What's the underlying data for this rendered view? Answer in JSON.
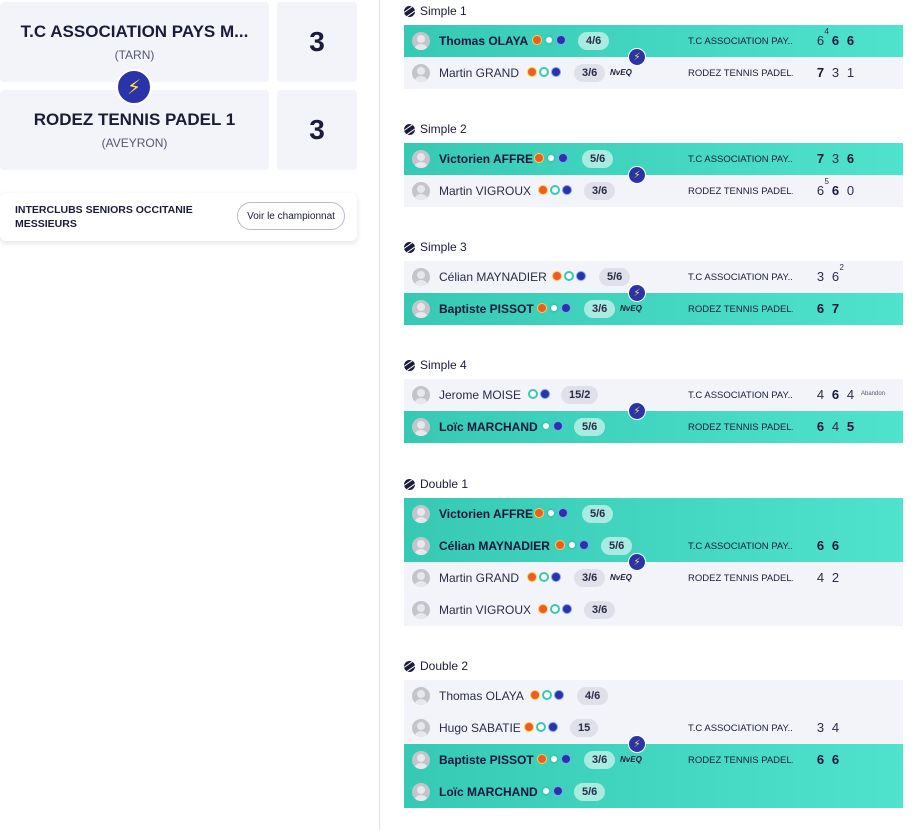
{
  "home_team": {
    "name": "T.C ASSOCIATION PAYS M...",
    "region": "(TARN)",
    "score": "3"
  },
  "away_team": {
    "name": "RODEZ TENNIS PADEL 1",
    "region": "(AVEYRON)",
    "score": "3"
  },
  "vs_icon": "lightning-icon",
  "championship": {
    "label_line1": "INTERCLUBS SENIORS OCCITANIE",
    "label_line2": "MESSIEURS",
    "button": "Voir le championnat"
  },
  "colors": {
    "winner_row": "#36c9b3",
    "badge": "#2a34a8",
    "bolt": "#ffe23a"
  },
  "matches": {
    "s1": {
      "title": "Simple 1",
      "r1": {
        "player": "Thomas OLAYA",
        "rank": "4/6",
        "nveq": "",
        "club": "T.C ASSOCIATION PAY...",
        "sets": [
          "6",
          "6",
          "6"
        ],
        "tb": [
          "4",
          "",
          ""
        ],
        "note": ""
      },
      "r2": {
        "player": "Martin GRAND",
        "rank": "3/6",
        "nveq": "NvEQ",
        "club": "RODEZ TENNIS PADEL...",
        "sets": [
          "7",
          "3",
          "1"
        ],
        "tb": [
          "",
          "",
          ""
        ],
        "note": ""
      }
    },
    "s2": {
      "title": "Simple 2",
      "r1": {
        "player": "Victorien AFFRE",
        "rank": "5/6",
        "nveq": "",
        "club": "T.C ASSOCIATION PAY...",
        "sets": [
          "7",
          "3",
          "6"
        ],
        "tb": [
          "",
          "",
          ""
        ],
        "note": ""
      },
      "r2": {
        "player": "Martin VIGROUX",
        "rank": "3/6",
        "nveq": "",
        "club": "RODEZ TENNIS PADEL...",
        "sets": [
          "6",
          "6",
          "0"
        ],
        "tb": [
          "5",
          "",
          ""
        ],
        "note": ""
      }
    },
    "s3": {
      "title": "Simple 3",
      "r1": {
        "player": "Célian MAYNADIER",
        "rank": "5/6",
        "nveq": "",
        "club": "T.C ASSOCIATION PAY...",
        "sets": [
          "3",
          "6"
        ],
        "tb": [
          "",
          "2"
        ],
        "note": ""
      },
      "r2": {
        "player": "Baptiste PISSOT",
        "rank": "3/6",
        "nveq": "NvEQ",
        "club": "RODEZ TENNIS PADEL...",
        "sets": [
          "6",
          "7"
        ],
        "tb": [
          "",
          ""
        ],
        "note": ""
      }
    },
    "s4": {
      "title": "Simple 4",
      "r1": {
        "player": "Jerome MOISE",
        "rank": "15/2",
        "nveq": "",
        "club": "T.C ASSOCIATION PAY...",
        "sets": [
          "4",
          "6",
          "4"
        ],
        "tb": [
          "",
          "",
          ""
        ],
        "note": "Abandon"
      },
      "r2": {
        "player": "Loïc MARCHAND",
        "rank": "5/6",
        "nveq": "",
        "club": "RODEZ TENNIS PADEL...",
        "sets": [
          "6",
          "4",
          "5"
        ],
        "tb": [
          "",
          "",
          ""
        ],
        "note": ""
      }
    },
    "d1": {
      "title": "Double 1",
      "r1": {
        "player": "Victorien AFFRE",
        "rank": "5/6"
      },
      "r2": {
        "player": "Célian MAYNADIER",
        "rank": "5/6",
        "club": "T.C ASSOCIATION PAY...",
        "sets": [
          "6",
          "6"
        ]
      },
      "r3": {
        "player": "Martin GRAND",
        "rank": "3/6",
        "nveq": "NvEQ",
        "club": "RODEZ TENNIS PADEL...",
        "sets": [
          "4",
          "2"
        ]
      },
      "r4": {
        "player": "Martin VIGROUX",
        "rank": "3/6"
      }
    },
    "d2": {
      "title": "Double 2",
      "r1": {
        "player": "Thomas OLAYA",
        "rank": "4/6"
      },
      "r2": {
        "player": "Hugo SABATIE",
        "rank": "15",
        "club": "T.C ASSOCIATION PAY...",
        "sets": [
          "3",
          "4"
        ]
      },
      "r3": {
        "player": "Baptiste PISSOT",
        "rank": "3/6",
        "nveq": "NvEQ",
        "club": "RODEZ TENNIS PADEL...",
        "sets": [
          "6",
          "6"
        ]
      },
      "r4": {
        "player": "Loïc MARCHAND",
        "rank": "5/6"
      }
    }
  }
}
